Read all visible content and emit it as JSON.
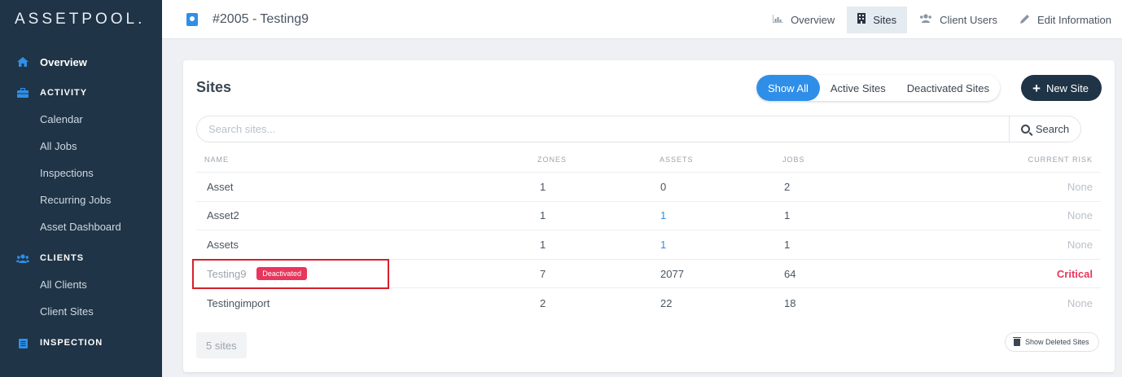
{
  "sidebar": {
    "logo": "ASSETPOOL.",
    "overview": "Overview",
    "sections": [
      {
        "label": "ACTIVITY",
        "items": [
          "Calendar",
          "All Jobs",
          "Inspections",
          "Recurring Jobs",
          "Asset Dashboard"
        ]
      },
      {
        "label": "CLIENTS",
        "items": [
          "All Clients",
          "Client Sites"
        ]
      },
      {
        "label": "INSPECTION",
        "items": []
      }
    ]
  },
  "header": {
    "title": "#2005 - Testing9",
    "nav": [
      {
        "label": "Overview",
        "icon": "chart-icon",
        "active": false
      },
      {
        "label": "Sites",
        "icon": "building-icon",
        "active": true
      },
      {
        "label": "Client Users",
        "icon": "users-icon",
        "active": false
      },
      {
        "label": "Edit Information",
        "icon": "pencil-icon",
        "active": false
      }
    ]
  },
  "main": {
    "title": "Sites",
    "filters": [
      "Show All",
      "Active Sites",
      "Deactivated Sites"
    ],
    "active_filter": "Show All",
    "new_site_label": "New Site",
    "search": {
      "placeholder": "Search sites...",
      "button": "Search"
    },
    "columns": [
      "NAME",
      "ZONES",
      "ASSETS",
      "JOBS",
      "CURRENT RISK"
    ],
    "rows": [
      {
        "name": "Asset",
        "zones": "1",
        "assets": "0",
        "jobs": "2",
        "risk": "None",
        "deactivated": false
      },
      {
        "name": "Asset2",
        "zones": "1",
        "assets": "1",
        "jobs": "1",
        "risk": "None",
        "deactivated": false
      },
      {
        "name": "Assets",
        "zones": "1",
        "assets": "1",
        "jobs": "1",
        "risk": "None",
        "deactivated": false
      },
      {
        "name": "Testing9",
        "badge": "Deactivated",
        "zones": "7",
        "assets": "2077",
        "jobs": "64",
        "risk": "Critical",
        "deactivated": true
      },
      {
        "name": "Testingimport",
        "zones": "2",
        "assets": "22",
        "jobs": "18",
        "risk": "None",
        "deactivated": false
      }
    ],
    "count_label": "5 sites",
    "show_deleted_label": "Show Deleted Sites"
  },
  "colors": {
    "accent": "#2f8fe8",
    "sidebar": "#1f3446",
    "critical": "#e8365d"
  }
}
